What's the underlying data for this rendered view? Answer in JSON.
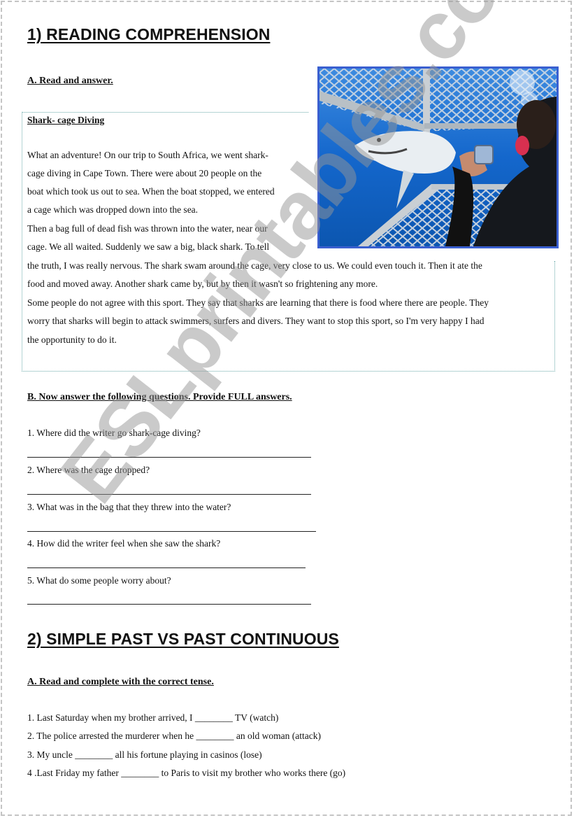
{
  "section1": {
    "title": "1) READING COMPREHENSION",
    "partA": {
      "heading": "A. Read and answer.",
      "story_title": "Shark- cage Diving",
      "story_lines": [
        "What an adventure! On our trip to South Africa, we went shark-",
        "cage diving in Cape Town. There were about 20 people on the",
        "boat which took us out to sea. When the boat stopped, we entered",
        "a cage which was dropped down into the sea.",
        "Then a bag full of dead fish was thrown into the water, near our",
        "cage. We all waited.  Suddenly we saw a big, black shark. To tell",
        "the truth, I was really nervous. The shark swam around the cage, very close to us. We could even touch it. Then it ate the",
        "food and moved away. Another shark came by, but by then it wasn't so frightening any more.",
        "Some people do not agree with this sport. They say that sharks are learning that there is food where there are people. They",
        "worry that sharks will begin to attack swimmers, surfers and divers. They want to stop this sport, so I'm very happy I had",
        "the opportunity to do it."
      ],
      "image": {
        "alt": "Great white shark next to a diving cage with a diver taking a photo",
        "border_color": "#3a5fd0"
      }
    },
    "partB": {
      "heading": "B. Now answer the following questions. Provide FULL answers.",
      "questions": [
        "1. Where did the writer go shark-cage diving?",
        "2. Where was the cage dropped?",
        "3. What was in the bag that they threw into the water?",
        "4. How did the writer feel when she saw the shark?",
        "5. What do some people worry about?"
      ]
    }
  },
  "section2": {
    "title": "2) SIMPLE PAST VS PAST CONTINUOUS",
    "partA": {
      "heading": "A. Read and complete with the correct tense.",
      "exercises": [
        "1.  Last Saturday when my brother arrived, I ________ TV (watch)",
        "2. The police arrested the murderer when he ________ an old woman (attack)",
        "3. My uncle ________ all his fortune playing in casinos (lose)",
        "4 .Last Friday my father ________ to Paris to visit my brother who works there (go)"
      ]
    }
  },
  "watermark": "ESLprintables.co"
}
